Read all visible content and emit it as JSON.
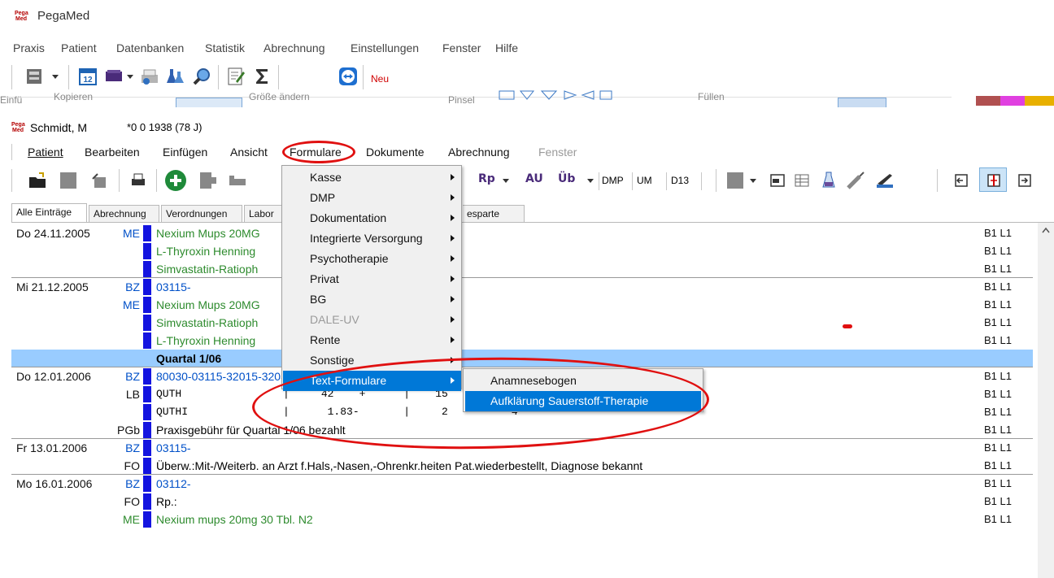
{
  "app": {
    "logo_text": "Pega Med",
    "title": "PegaMed"
  },
  "main_menu": [
    "Praxis",
    "Patient",
    "Datenbanken",
    "Statistik",
    "Abrechnung",
    "Einstellungen",
    "Fenster",
    "Hilfe"
  ],
  "main_toolbar": {
    "new_label": "Neu"
  },
  "background_remnant_text": [
    "Kopieren",
    "Größe ändern",
    "Einfü",
    "Pinsel",
    "Füllen"
  ],
  "patient": {
    "name": "Schmidt, M",
    "birth": "*0  0  1938 (78 J)"
  },
  "submenu": [
    "Patient",
    "Bearbeiten",
    "Einfügen",
    "Ansicht",
    "Formulare",
    "Dokumente",
    "Abrechnung",
    "Fenster"
  ],
  "toolbar2": {
    "rp": "Rp",
    "au": "AU",
    "ub": "Üb",
    "dmp": "DMP",
    "um": "UM",
    "d13": "D13"
  },
  "tabs": [
    "Alle Einträge",
    "Abrechnung",
    "Verordnungen",
    "Labor",
    "esparte"
  ],
  "journal": [
    {
      "date": "Do  24.11.2005",
      "code": "ME",
      "code_color": "blue",
      "text": "Nexium Mups 20MG",
      "text_color": "green",
      "bl": "B1 L1"
    },
    {
      "date": "",
      "code": "",
      "text": "L-Thyroxin Henning",
      "text_color": "green",
      "bl": "B1 L1"
    },
    {
      "date": "",
      "code": "",
      "text": "Simvastatin-Ratioph",
      "text_color": "green",
      "bl": "B1 L1"
    },
    {
      "date": "Mi  21.12.2005",
      "code": "BZ",
      "code_color": "blue",
      "text": "03115-",
      "text_color": "blue",
      "bl": "B1 L1"
    },
    {
      "date": "",
      "code": "ME",
      "code_color": "blue",
      "text": "Nexium Mups 20MG",
      "text_color": "green",
      "bl": "B1 L1"
    },
    {
      "date": "",
      "code": "",
      "text": "Simvastatin-Ratioph",
      "text_color": "green",
      "bl": "B1 L1"
    },
    {
      "date": "",
      "code": "",
      "text": "L-Thyroxin Henning",
      "text_color": "green",
      "bl": "B1 L1"
    },
    {
      "quartal": "Quartal 1/06"
    },
    {
      "date": "Do  12.01.2006",
      "code": "BZ",
      "code_color": "blue",
      "text": "80030-03115-32015-32030-32113",
      "text_color": "blue",
      "bl": "B1 L1"
    },
    {
      "date": "",
      "code": "LB",
      "code_color": "black",
      "mono": true,
      "text": "QUTH                |     42    +      |    15    -    35    %",
      "bl": "B1 L1"
    },
    {
      "date": "",
      "code": "",
      "mono": true,
      "text": "QUTHI               |      1.83-       |     2    -     4",
      "bl": "B1 L1"
    },
    {
      "date": "",
      "code": "PGb",
      "code_color": "black",
      "text": "Praxisgebühr für Quartal 1/06 bezahlt",
      "text_color": "black",
      "bl": "B1 L1"
    },
    {
      "date": "Fr   13.01.2006",
      "code": "BZ",
      "code_color": "blue",
      "text": "03115-",
      "text_color": "blue",
      "bl": "B1 L1"
    },
    {
      "date": "",
      "code": "FO",
      "code_color": "black",
      "text": "Überw.:Mit-/Weiterb. an Arzt f.Hals,-Nasen,-Ohrenkr.heiten Pat.wiederbestellt, Diagnose bekannt",
      "text_color": "black",
      "bl": "B1 L1"
    },
    {
      "date": "Mo  16.01.2006",
      "code": "BZ",
      "code_color": "blue",
      "text": "03112-",
      "text_color": "blue",
      "bl": "B1 L1"
    },
    {
      "date": "",
      "code": "FO",
      "code_color": "black",
      "text": "Rp.:",
      "text_color": "black",
      "bl": "B1 L1"
    },
    {
      "date": "",
      "code": "ME",
      "code_color": "green",
      "text": "Nexium mups 20mg 30 Tbl. N2",
      "text_color": "green",
      "bl": "B1 L1"
    }
  ],
  "formulare_menu": [
    {
      "label": "Kasse",
      "submenu": true
    },
    {
      "label": "DMP",
      "submenu": true
    },
    {
      "label": "Dokumentation",
      "submenu": true
    },
    {
      "label": "Integrierte Versorgung",
      "submenu": true
    },
    {
      "label": "Psychotherapie",
      "submenu": true
    },
    {
      "label": "Privat",
      "submenu": true
    },
    {
      "label": "BG",
      "submenu": true
    },
    {
      "label": "DALE-UV",
      "submenu": true,
      "disabled": true
    },
    {
      "label": "Rente",
      "submenu": true
    },
    {
      "label": "Sonstige",
      "submenu": true
    },
    {
      "label": "Text-Formulare",
      "submenu": true,
      "highlighted": true
    }
  ],
  "text_formulare_submenu": [
    {
      "label": "Anamnesebogen"
    },
    {
      "label": "Aufklärung Sauerstoff-Therapie",
      "highlighted": true
    }
  ],
  "colors": {
    "highlight": "#0078d7",
    "quartal_bg": "#99ccff",
    "annotation": "#e01010",
    "entry_bar": "#1414e0"
  }
}
